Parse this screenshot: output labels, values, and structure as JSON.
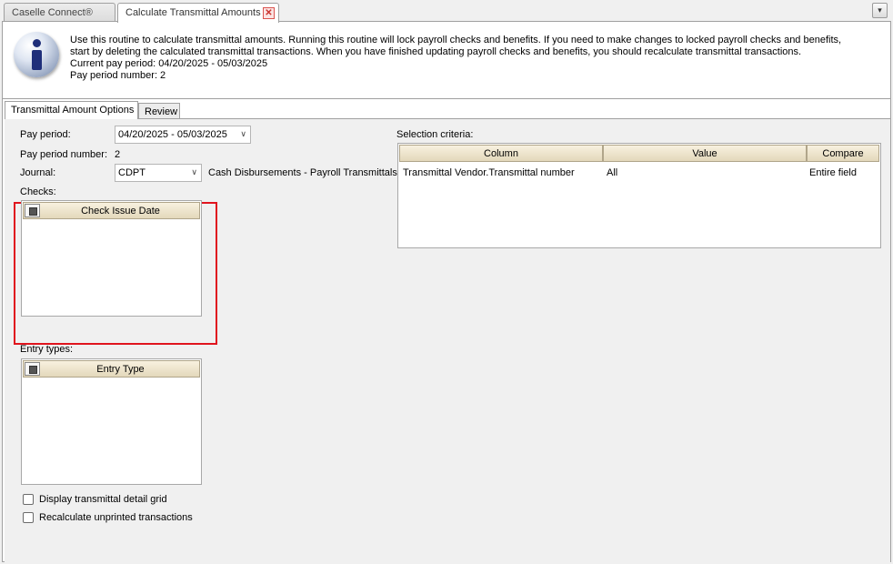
{
  "tabs": {
    "home": "Caselle Connect®",
    "current": "Calculate Transmittal Amounts",
    "close_glyph": "✕",
    "menu_glyph": "▾"
  },
  "info": {
    "icon": "info-icon",
    "line1": "Use this routine to calculate transmittal amounts. Running this routine will lock payroll checks and benefits. If you need to make changes to locked payroll checks and benefits,",
    "line2": "start by deleting the calculated transmittal transactions. When you have finished updating payroll checks and benefits, you should recalculate transmittal transactions.",
    "line3": "Current pay period: 04/20/2025 - 05/03/2025",
    "line4": "Pay period number: 2"
  },
  "inner_tabs": {
    "options": "Transmittal Amount Options",
    "review": "Review"
  },
  "form": {
    "pay_period_label": "Pay period:",
    "pay_period_value": "04/20/2025 - 05/03/2025",
    "pay_period_number_label": "Pay period number:",
    "pay_period_number_value": "2",
    "journal_label": "Journal:",
    "journal_value": "CDPT",
    "journal_desc": "Cash Disbursements - Payroll Transmittals",
    "chevron": "∨"
  },
  "checks": {
    "label": "Checks:",
    "column": "Check Issue Date"
  },
  "entry_types": {
    "label": "Entry types:",
    "column": "Entry Type"
  },
  "options": {
    "display_grid": "Display transmittal detail grid",
    "recalculate": "Recalculate unprinted transactions"
  },
  "criteria": {
    "label": "Selection criteria:",
    "headers": [
      "Column",
      "Value",
      "Compare"
    ],
    "rows": [
      [
        "Transmittal Vendor.Transmittal number",
        "All",
        "Entire field"
      ]
    ]
  },
  "colors": {
    "highlight": "#e0141e",
    "grid_header": "#ece3c8"
  }
}
